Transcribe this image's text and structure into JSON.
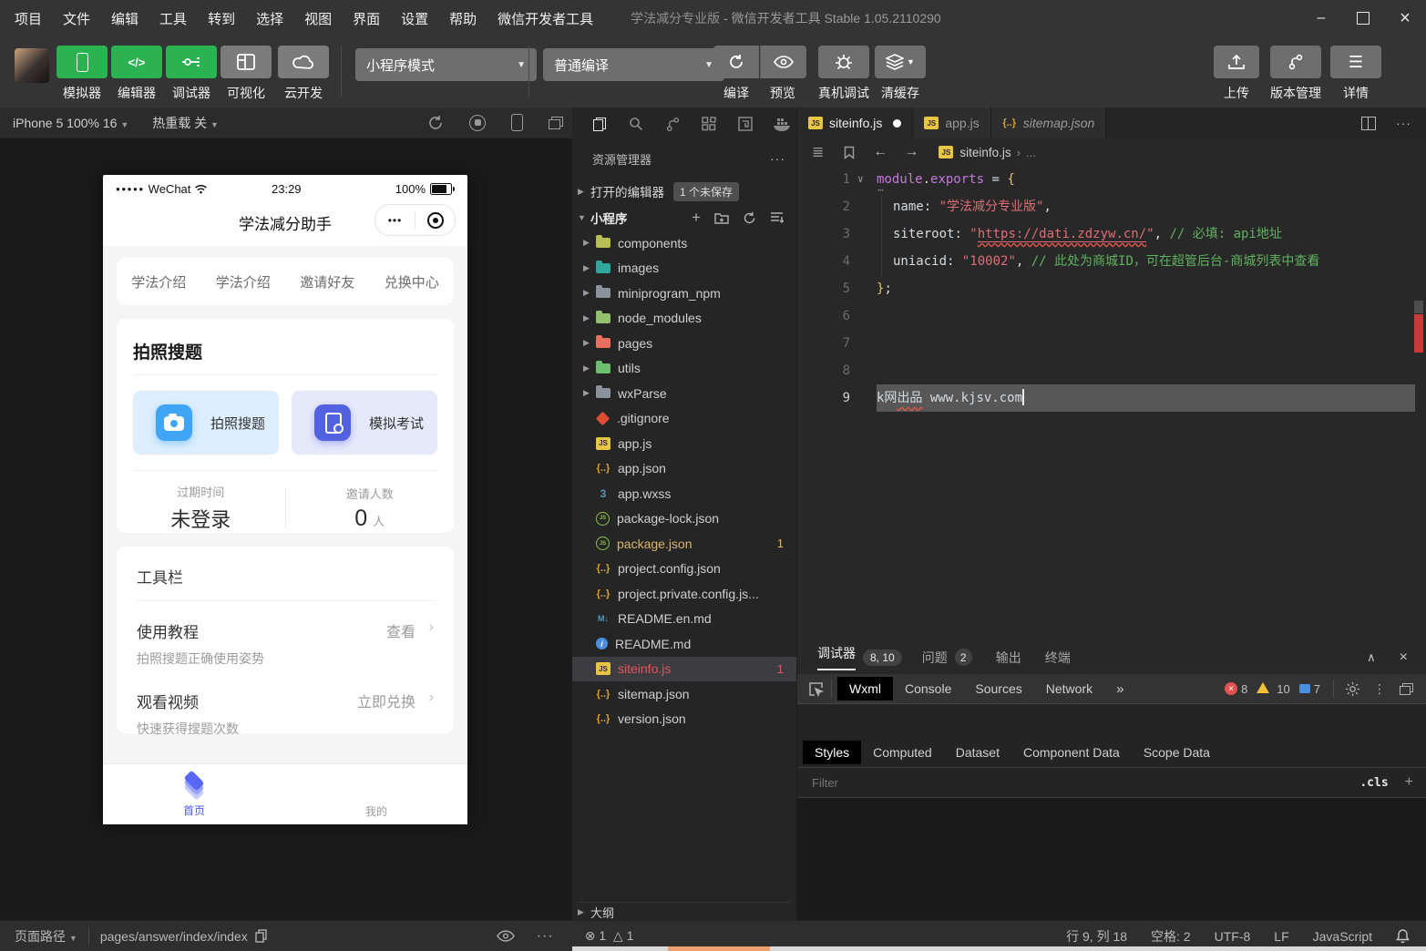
{
  "colors": {
    "wechat_green": "#2bb352",
    "accent_blue": "#5668f5",
    "error_red": "#e2575f",
    "modified_yellow": "#d9b668",
    "string_red": "#e06c75",
    "comment_green": "#5fb25f",
    "keyword_magenta": "#c678dd"
  },
  "icons": {
    "compile": "refresh-arrow",
    "preview": "eye",
    "real_device": "bug",
    "clear_cache": "layers",
    "upload": "upload-arrow",
    "version": "git-branch",
    "detail": "hamburger"
  },
  "window": {
    "menu": [
      "项目",
      "文件",
      "编辑",
      "工具",
      "转到",
      "选择",
      "视图",
      "界面",
      "设置",
      "帮助",
      "微信开发者工具"
    ],
    "title_app": "学法减分专业版",
    "title_rest": "- 微信开发者工具 Stable 1.05.2110290",
    "minimize": "–",
    "maximize": "",
    "close": "×"
  },
  "toolbar": {
    "simulator": "模拟器",
    "editor": "编辑器",
    "debugger": "调试器",
    "visual": "可视化",
    "cloud": "云开发",
    "mode": "小程序模式",
    "compile_mode": "普通编译",
    "compile": "编译",
    "preview": "预览",
    "real_device": "真机调试",
    "clear_cache": "清缓存",
    "upload": "上传",
    "version": "版本管理",
    "detail": "详情"
  },
  "simbar": {
    "device": "iPhone 5 100% 16",
    "hot_reload": "热重载 关"
  },
  "phone": {
    "signal": "●●●●●",
    "carrier": "WeChat",
    "time": "23:29",
    "battery": "100%",
    "nav_title": "学法减分助手",
    "capsule_dots": "•••",
    "links": [
      "学法介绍",
      "学法介绍",
      "邀请好友",
      "兑换中心"
    ],
    "card1": {
      "title": "拍照搜题",
      "btn1": "拍照搜题",
      "btn2": "模拟考试",
      "stat1_label": "过期时间",
      "stat1_value": "未登录",
      "stat2_label": "邀请人数",
      "stat2_value": "0",
      "stat2_unit": "人"
    },
    "card2": {
      "title": "工具栏",
      "row1": "使用教程",
      "row1_action": "查看",
      "row1_sub": "拍照搜题正确使用姿势",
      "row2": "观看视频",
      "row2_action": "立即兑换",
      "row2_sub": "快速获得搜题次数"
    },
    "tabbar": [
      {
        "label": "首页"
      },
      {
        "label": "我的"
      }
    ]
  },
  "explorer": {
    "title": "资源管理器",
    "more": "···",
    "open_editors": "打开的编辑器",
    "unsaved": "1 个未保存",
    "project": "小程序",
    "outline": "大纲",
    "files": [
      {
        "name": "components"
      },
      {
        "name": "images"
      },
      {
        "name": "miniprogram_npm"
      },
      {
        "name": "node_modules"
      },
      {
        "name": "pages"
      },
      {
        "name": "utils"
      },
      {
        "name": "wxParse"
      },
      {
        "name": ".gitignore"
      },
      {
        "name": "app.js"
      },
      {
        "name": "app.json"
      },
      {
        "name": "app.wxss"
      },
      {
        "name": "package-lock.json"
      },
      {
        "name": "package.json",
        "badge": "1"
      },
      {
        "name": "project.config.json"
      },
      {
        "name": "project.private.config.js..."
      },
      {
        "name": "README.en.md"
      },
      {
        "name": "README.md"
      },
      {
        "name": "siteinfo.js",
        "badge": "1"
      },
      {
        "name": "sitemap.json"
      },
      {
        "name": "version.json"
      }
    ]
  },
  "editor": {
    "tabs": [
      {
        "label": "siteinfo.js"
      },
      {
        "label": "app.js"
      },
      {
        "label": "sitemap.json"
      }
    ],
    "breadcrumb_file": "siteinfo.js",
    "breadcrumb_more": "...",
    "fold_dots": "⋯",
    "code": [
      {
        "n": "1",
        "tokens": [
          {
            "t": "module"
          },
          {
            "t": "."
          },
          {
            "t": "exports"
          },
          {
            "t": " = "
          },
          {
            "t": "{"
          }
        ]
      },
      {
        "n": "2",
        "tokens": [
          {
            "t": "name"
          },
          {
            "t": ": "
          },
          {
            "t": "\"学法减分专业版\""
          },
          {
            "t": ","
          }
        ]
      },
      {
        "n": "3",
        "tokens": [
          {
            "t": "siteroot"
          },
          {
            "t": ": "
          },
          {
            "t": "\""
          },
          {
            "t": "https://dati.zdzyw.cn/"
          },
          {
            "t": "\""
          },
          {
            "t": ", "
          },
          {
            "t": "// 必填: api地址"
          }
        ]
      },
      {
        "n": "4",
        "tokens": [
          {
            "t": "uniacid"
          },
          {
            "t": ": "
          },
          {
            "t": "\"10002\""
          },
          {
            "t": ", "
          },
          {
            "t": "// 此处为商城ID，可在超管后台-商城列表中查看"
          }
        ]
      },
      {
        "n": "5",
        "tokens": [
          {
            "t": "}"
          },
          {
            "t": ";"
          }
        ]
      },
      {
        "n": "6"
      },
      {
        "n": "7"
      },
      {
        "n": "8"
      },
      {
        "n": "9",
        "tokens": [
          {
            "t": "k网"
          },
          {
            "t": "出品"
          },
          {
            "t": " www.kjsv.com"
          }
        ]
      }
    ]
  },
  "devtools": {
    "debugger": "调试器",
    "debugger_badge": "8, 10",
    "problems": "问题",
    "problems_badge": "2",
    "output": "输出",
    "terminal": "终端",
    "tabs": [
      "Wxml",
      "Console",
      "Sources",
      "Network"
    ],
    "more": "»",
    "err_count": "8",
    "warn_count": "10",
    "msg_count": "7",
    "style_tabs": [
      "Styles",
      "Computed",
      "Dataset",
      "Component Data",
      "Scope Data"
    ],
    "filter_placeholder": "Filter",
    "cls_label": ".cls"
  },
  "statusbar": {
    "path_label": "页面路径",
    "path": "pages/answer/index/index",
    "err": "1",
    "warn": "1",
    "cursor_pos": "行 9, 列 18",
    "indent": "空格: 2",
    "encoding": "UTF-8",
    "eol": "LF",
    "language": "JavaScript"
  }
}
